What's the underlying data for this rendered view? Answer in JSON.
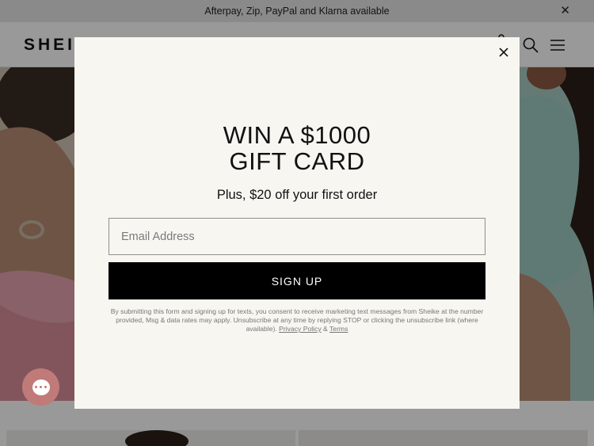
{
  "announcement": {
    "text": "Afterpay, Zip, PayPal and Klarna available",
    "close_icon": "close-icon"
  },
  "header": {
    "logo": "SHEIKE",
    "icons": [
      "account-icon",
      "search-icon",
      "menu-icon"
    ]
  },
  "modal": {
    "headline_line1": "WIN A $1000",
    "headline_line2": "GIFT CARD",
    "subheadline": "Plus, $20 off your first order",
    "email_placeholder": "Email Address",
    "email_value": "",
    "signup_label": "SIGN UP",
    "legal_text": "By submitting this form and signing up for texts, you consent to receive marketing text messages from Sheike at the number provided, Msg & data rates may apply. Unsubscribe at any time by replying STOP or clicking the unsubscribe link (where available).",
    "privacy_link": "Privacy Policy",
    "link_joiner": "&",
    "terms_link": "Terms"
  },
  "chat": {
    "icon": "chat-icon"
  },
  "colors": {
    "modal_background": "#f8f6f1",
    "button_background": "#000000",
    "chat_button": "#c07a78"
  }
}
